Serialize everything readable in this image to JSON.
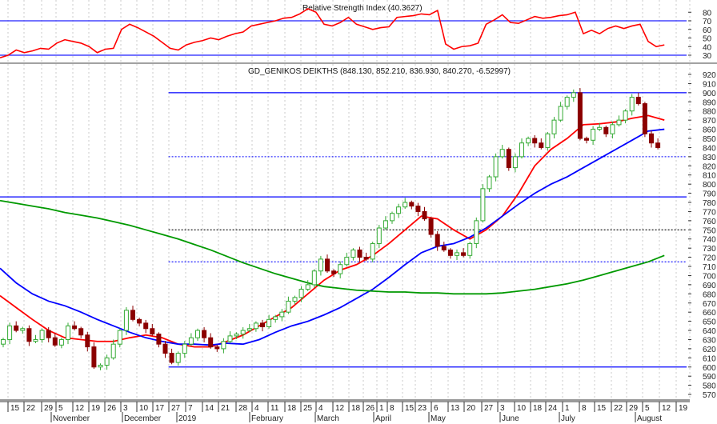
{
  "chart_data": {
    "type": "candlestick",
    "rsi_panel": {
      "title": "Relative Strength Index (40.3627)",
      "y_ticks": [
        80,
        70,
        60,
        50,
        40,
        30
      ],
      "levels": [
        70,
        30
      ],
      "step_days": 2.5,
      "values": [
        27,
        30,
        36,
        33,
        35,
        38,
        37,
        44,
        48,
        46,
        44,
        40,
        33,
        37,
        38,
        60,
        66,
        62,
        57,
        52,
        45,
        38,
        36,
        42,
        45,
        47,
        50,
        48,
        52,
        55,
        57,
        64,
        66,
        68,
        70,
        73,
        74,
        78,
        84,
        80,
        66,
        64,
        68,
        74,
        66,
        63,
        60,
        62,
        63,
        74,
        75,
        76,
        78,
        77,
        82,
        43,
        37,
        40,
        41,
        44,
        66,
        71,
        77,
        68,
        67,
        71,
        75,
        73,
        74,
        76,
        77,
        80,
        55,
        59,
        55,
        61,
        64,
        61,
        64,
        66,
        46,
        40,
        42
      ],
      "color": "#ff0000"
    },
    "price_panel": {
      "title": "GD_GENIKOS DEIKTHS (848.130, 852.210, 836.930, 840.270, -6.52997)",
      "y_ticks": [
        920,
        910,
        900,
        890,
        880,
        870,
        860,
        850,
        840,
        830,
        820,
        810,
        800,
        790,
        780,
        770,
        760,
        750,
        740,
        730,
        720,
        710,
        700,
        690,
        680,
        670,
        660,
        650,
        640,
        630,
        620,
        610,
        600,
        590,
        580,
        570
      ],
      "ylim": [
        570,
        920
      ],
      "candle_step_days": 2,
      "first_open": 625,
      "closes": [
        630,
        645,
        640,
        642,
        628,
        630,
        640,
        632,
        624,
        630,
        645,
        642,
        635,
        622,
        600,
        602,
        610,
        625,
        640,
        662,
        652,
        648,
        642,
        636,
        625,
        615,
        605,
        615,
        625,
        632,
        640,
        632,
        622,
        620,
        628,
        634,
        636,
        640,
        642,
        648,
        644,
        652,
        655,
        660,
        672,
        676,
        685,
        690,
        705,
        718,
        705,
        702,
        712,
        720,
        728,
        720,
        718,
        735,
        752,
        760,
        768,
        775,
        780,
        776,
        770,
        762,
        745,
        732,
        728,
        722,
        725,
        722,
        735,
        760,
        795,
        808,
        830,
        838,
        818,
        830,
        845,
        850,
        845,
        840,
        855,
        870,
        885,
        895,
        900,
        850,
        848,
        860,
        862,
        855,
        865,
        870,
        880,
        895,
        888,
        855,
        845,
        840
      ],
      "up_color": "#33aa33",
      "down_color": "#8b0000",
      "moving_averages": [
        {
          "name": "short MA",
          "color": "#ff0000",
          "step_days": 5,
          "values": [
            678,
            665,
            652,
            640,
            632,
            630,
            628,
            628,
            632,
            635,
            632,
            625,
            622,
            622,
            628,
            635,
            645,
            655,
            665,
            680,
            695,
            706,
            712,
            722,
            735,
            750,
            765,
            762,
            750,
            740,
            750,
            765,
            790,
            820,
            838,
            850,
            865,
            866,
            868,
            872,
            875,
            870
          ]
        },
        {
          "name": "medium MA",
          "color": "#0000ff",
          "step_days": 5,
          "values": [
            708,
            692,
            680,
            672,
            667,
            660,
            652,
            645,
            638,
            632,
            628,
            625,
            625,
            624,
            626,
            625,
            630,
            638,
            645,
            650,
            657,
            665,
            675,
            685,
            698,
            712,
            725,
            732,
            735,
            742,
            752,
            765,
            778,
            790,
            800,
            808,
            818,
            828,
            838,
            848,
            858,
            860
          ]
        },
        {
          "name": "long MA",
          "color": "#009900",
          "step_days": 5,
          "values": [
            782,
            779,
            776,
            773,
            769,
            766,
            763,
            759,
            755,
            750,
            745,
            740,
            734,
            728,
            721,
            714,
            708,
            702,
            697,
            692,
            688,
            686,
            684,
            683,
            682,
            682,
            681,
            681,
            680,
            680,
            680,
            681,
            683,
            685,
            688,
            691,
            695,
            700,
            705,
            710,
            715,
            722
          ]
        }
      ],
      "horizontal_levels": [
        {
          "value": 900,
          "style": "solid",
          "color": "#0000ff",
          "from_day": 52
        },
        {
          "value": 830,
          "style": "dotted",
          "color": "#0000ff",
          "from_day": 52
        },
        {
          "value": 786,
          "style": "solid",
          "color": "#0000ff",
          "from_day": 0
        },
        {
          "value": 750,
          "style": "dotted",
          "color": "#000000",
          "from_day": 52
        },
        {
          "value": 715,
          "style": "dotted",
          "color": "#0000ff",
          "from_day": 52
        },
        {
          "value": 600,
          "style": "solid",
          "color": "#0000ff",
          "from_day": 52
        }
      ]
    },
    "x_axis": {
      "day_labels": [
        "15",
        "22",
        "29",
        "5",
        "12",
        "19",
        "26",
        "3",
        "10",
        "17",
        "27",
        "7",
        "14",
        "21",
        "28",
        "4",
        "11",
        "18",
        "25",
        "4",
        "12",
        "18",
        "26",
        "1",
        "8",
        "15",
        "23",
        "6",
        "13",
        "20",
        "27",
        "3",
        "10",
        "18",
        "24",
        "1",
        "8",
        "15",
        "22",
        "29",
        "5",
        "12",
        "19"
      ],
      "month_labels": [
        "November",
        "December",
        "2019",
        "February",
        "March",
        "April",
        "May",
        "June",
        "July",
        "August"
      ]
    },
    "grid": "vertical dotted"
  }
}
